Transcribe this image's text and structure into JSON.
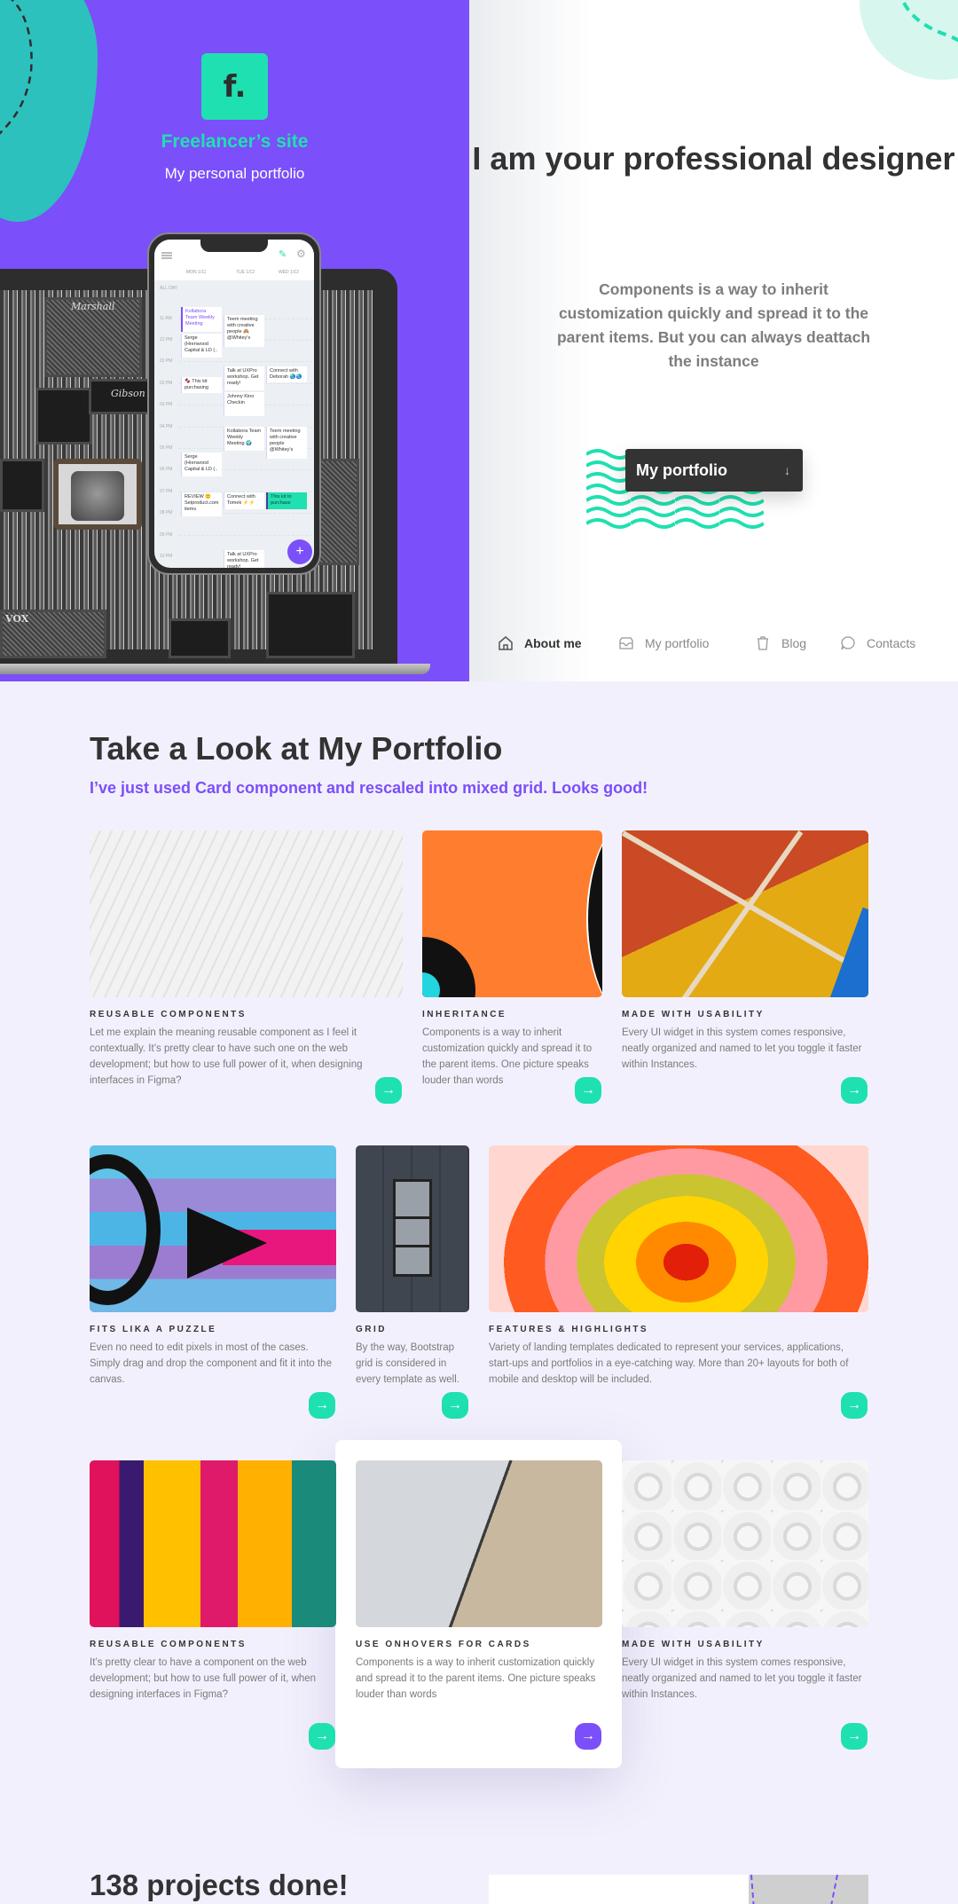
{
  "hero": {
    "logo_letter": "f.",
    "site_title": "Freelancer’s site",
    "site_subtitle": "My personal portfolio",
    "headline": "I am your professional designer",
    "description": "Components is a way to inherit customization quickly and spread it to the parent items. But you can always deattach the instance",
    "cta_label": "My portfolio",
    "cta_icon": "arrow-down-icon"
  },
  "phone": {
    "days": [
      "MON 1/11",
      "TUE 1/12",
      "WED 1/13"
    ],
    "all_day": "ALL DAY",
    "hours": [
      "11 AM",
      "12 PM",
      "01 PM",
      "02 PM",
      "03 PM",
      "04 PM",
      "05 PM",
      "06 PM",
      "07 PM",
      "08 PM",
      "09 PM",
      "10 PM"
    ],
    "events": [
      "Kollabora Team Weekly Meeting",
      "Teem meeting with creative people 🙈 @Whitey's",
      "Serge (Hrenwood Capital & LD (..",
      "Talk at UXPro workshop. Get ready!",
      "Connect with Deborah 🌏🌏",
      "🍫 This kit purchasing",
      "Johnny Kino Checkin",
      "Kollabora Team Weekly Meeting 🌍",
      "Teem meeting with creative people @Whitey's",
      "Serge (Hrenwood Capital & LD (..",
      "REVIEW 🙂 Setproduct.com items",
      "Connect with Tomek ⚡⚡",
      "This kit to purchase",
      "Talk at UXPro workshop. Get ready!"
    ],
    "fab": "+"
  },
  "nav": [
    {
      "label": "About me",
      "icon": "home-icon",
      "active": true
    },
    {
      "label": "My portfolio",
      "icon": "inbox-icon",
      "active": false
    },
    {
      "label": "Blog",
      "icon": "trash-icon",
      "active": false
    },
    {
      "label": "Contacts",
      "icon": "chat-icon",
      "active": false
    }
  ],
  "portfolio": {
    "title": "Take a Look at My Portfolio",
    "subtitle": "I’ve just used Card component and rescaled into mixed grid. Looks good!",
    "cards": [
      {
        "title": "REUSABLE COMPONENTS",
        "text": "Let me explain the meaning reusable component as I feel it contextually. It’s pretty clear to have such one on the web development; but how to use full power of it, when designing interfaces in Figma?"
      },
      {
        "title": "INHERITANCE",
        "text": "Components is a way to inherit customization quickly and spread it to the parent items. One picture speaks louder than words"
      },
      {
        "title": "MADE WITH USABILITY",
        "text": "Every UI widget in this system comes responsive, neatly organized and named to let you toggle it faster within Instances."
      },
      {
        "title": "FITS LIKA A PUZZLE",
        "text": "Even no need to edit pixels in most of the cases. Simply drag and drop the component and fit it into the canvas."
      },
      {
        "title": "GRID",
        "text": "By the way, Bootstrap grid is considered in every template as well."
      },
      {
        "title": "FEATURES & HIGHLIGHTS",
        "text": "Variety of landing templates dedicated to represent your services, applications, start-ups and portfolios in a eye-catching way. More than 20+ layouts for both of mobile and desktop will be included."
      },
      {
        "title": "REUSABLE COMPONENTS",
        "text": "It’s pretty clear to have a component on the web development; but how to use full power of it, when designing interfaces in Figma?"
      },
      {
        "title": "USE ONHOVERS FOR CARDS",
        "text": "Components is a way to inherit customization quickly and spread it to the parent items. One picture speaks louder than words"
      },
      {
        "title": "MADE WITH USABILITY",
        "text": "Every UI widget in this system comes responsive, neatly organized and named to let you toggle it faster within Instances."
      }
    ],
    "card_button_icon": "→"
  },
  "stats": {
    "title": "138 projects done!"
  },
  "colors": {
    "primary": "#7b4ff9",
    "accent": "#1fe0b0",
    "dark": "#333333",
    "background": "#f3f0fd"
  }
}
